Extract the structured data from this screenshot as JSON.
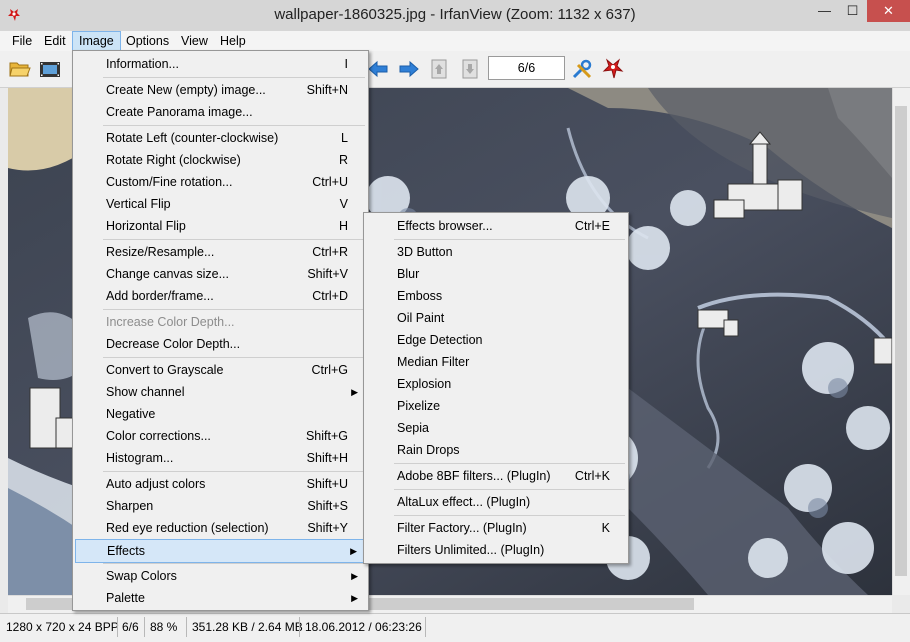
{
  "window": {
    "title": "wallpaper-1860325.jpg - IrfanView (Zoom: 1132 x 637)",
    "controls": {
      "minimize": "—",
      "maximize": "☐",
      "close": "✕"
    }
  },
  "menubar": [
    "File",
    "Edit",
    "Image",
    "Options",
    "View",
    "Help"
  ],
  "toolbar": {
    "icons": [
      "open-folder-icon",
      "filmstrip-icon",
      "arrow-left-icon",
      "arrow-right-icon",
      "page-up-icon",
      "page-down-icon",
      "tools-icon",
      "irfanview-logo-icon"
    ],
    "page_indicator": "6/6"
  },
  "image_menu": [
    {
      "label": "Information...",
      "shortcut": "I"
    },
    {
      "sep": true
    },
    {
      "label": "Create New (empty) image...",
      "shortcut": "Shift+N"
    },
    {
      "label": "Create Panorama image...",
      "shortcut": ""
    },
    {
      "sep": true
    },
    {
      "label": "Rotate Left (counter-clockwise)",
      "shortcut": "L"
    },
    {
      "label": "Rotate Right (clockwise)",
      "shortcut": "R"
    },
    {
      "label": "Custom/Fine rotation...",
      "shortcut": "Ctrl+U"
    },
    {
      "label": "Vertical Flip",
      "shortcut": "V"
    },
    {
      "label": "Horizontal Flip",
      "shortcut": "H"
    },
    {
      "sep": true
    },
    {
      "label": "Resize/Resample...",
      "shortcut": "Ctrl+R"
    },
    {
      "label": "Change canvas size...",
      "shortcut": "Shift+V"
    },
    {
      "label": "Add border/frame...",
      "shortcut": "Ctrl+D"
    },
    {
      "sep": true
    },
    {
      "label": "Increase Color Depth...",
      "shortcut": "",
      "disabled": true
    },
    {
      "label": "Decrease Color Depth...",
      "shortcut": ""
    },
    {
      "sep": true
    },
    {
      "label": "Convert to Grayscale",
      "shortcut": "Ctrl+G"
    },
    {
      "label": "Show channel",
      "shortcut": "",
      "submenu": true
    },
    {
      "label": "Negative",
      "shortcut": ""
    },
    {
      "label": "Color corrections...",
      "shortcut": "Shift+G"
    },
    {
      "label": "Histogram...",
      "shortcut": "Shift+H"
    },
    {
      "sep": true
    },
    {
      "label": "Auto adjust colors",
      "shortcut": "Shift+U"
    },
    {
      "label": "Sharpen",
      "shortcut": "Shift+S"
    },
    {
      "label": "Red eye reduction (selection)",
      "shortcut": "Shift+Y"
    },
    {
      "label": "Effects",
      "shortcut": "",
      "submenu": true,
      "highlighted": true
    },
    {
      "sep": true
    },
    {
      "label": "Swap Colors",
      "shortcut": "",
      "submenu": true
    },
    {
      "label": "Palette",
      "shortcut": "",
      "submenu": true
    }
  ],
  "effects_menu": [
    {
      "label": "Effects browser...",
      "shortcut": "Ctrl+E"
    },
    {
      "sep": true
    },
    {
      "label": "3D Button",
      "shortcut": ""
    },
    {
      "label": "Blur",
      "shortcut": ""
    },
    {
      "label": "Emboss",
      "shortcut": ""
    },
    {
      "label": "Oil Paint",
      "shortcut": ""
    },
    {
      "label": "Edge Detection",
      "shortcut": ""
    },
    {
      "label": "Median Filter",
      "shortcut": ""
    },
    {
      "label": "Explosion",
      "shortcut": ""
    },
    {
      "label": "Pixelize",
      "shortcut": ""
    },
    {
      "label": "Sepia",
      "shortcut": ""
    },
    {
      "label": "Rain Drops",
      "shortcut": ""
    },
    {
      "sep": true
    },
    {
      "label": "Adobe 8BF filters... (PlugIn)",
      "shortcut": "Ctrl+K"
    },
    {
      "sep": true
    },
    {
      "label": "AltaLux effect... (PlugIn)",
      "shortcut": ""
    },
    {
      "sep": true
    },
    {
      "label": "Filter Factory... (PlugIn)",
      "shortcut": "K"
    },
    {
      "label": "Filters Unlimited... (PlugIn)",
      "shortcut": ""
    }
  ],
  "status": {
    "dimensions": "1280 x 720 x 24 BPP",
    "index": "6/6",
    "zoom": "88 %",
    "size": "351.28 KB / 2.64 MB",
    "datetime": "18.06.2012 / 06:23:26"
  },
  "colors": {
    "highlight": "#d5e7f8",
    "close": "#c7504e"
  }
}
